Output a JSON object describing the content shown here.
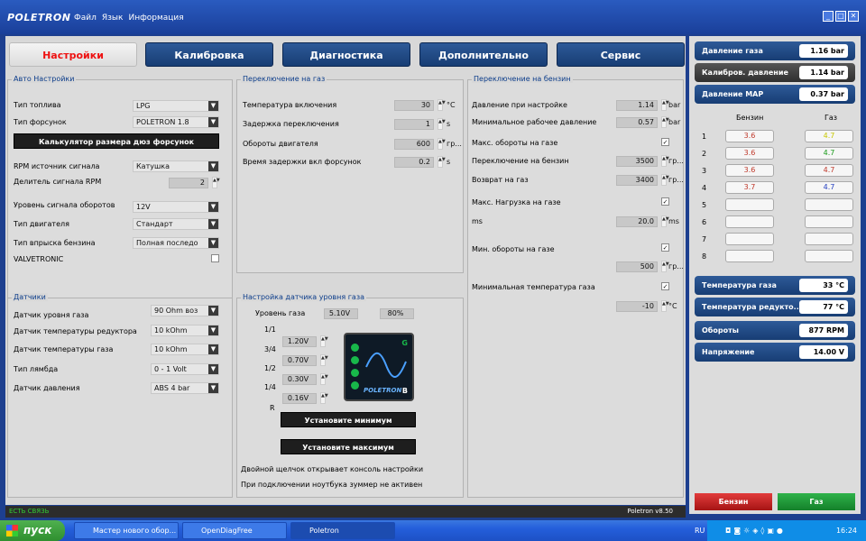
{
  "app": {
    "logo": "POLETRON",
    "menu": [
      "Файл",
      "Язык",
      "Информация"
    ]
  },
  "tabs": [
    "Настройки",
    "Калибровка",
    "Диагностика",
    "Дополнительно",
    "Сервис"
  ],
  "auto": {
    "title": "Авто Настройки",
    "fuel_type_label": "Тип топлива",
    "fuel_type": "LPG",
    "injector_type_label": "Тип форсунок",
    "injector_type": "POLETRON 1.8",
    "calc_button": "Калькулятор размера дюз форсунок",
    "rpm_source_label": "RPM источник сигнала",
    "rpm_source": "Катушка",
    "rpm_divider_label": "Делитель сигнала RPM",
    "rpm_divider": "2",
    "rpm_level_label": "Уровень сигнала оборотов",
    "rpm_level": "12V",
    "engine_type_label": "Тип двигателя",
    "engine_type": "Стандарт",
    "injection_type_label": "Тип впрыска бензина",
    "injection_type": "Полная последо",
    "valvetronic_label": "VALVETRONIC"
  },
  "gas_switch": {
    "title": "Переключение на газ",
    "temp_label": "Температура включения",
    "temp": "30",
    "temp_unit": "°C",
    "delay_label": "Задержка переключения",
    "delay": "1",
    "delay_unit": "s",
    "rpm_label": "Обороты двигателя",
    "rpm": "600",
    "rpm_unit": "гр...",
    "inj_delay_label": "Время задержки вкл форсунок",
    "inj_delay": "0.2",
    "inj_delay_unit": "s"
  },
  "petrol_switch": {
    "title": "Переключение на бензин",
    "pressure_label": "Давление при настройке",
    "pressure": "1.14",
    "pressure_unit": "bar",
    "min_pressure_label": "Минимальное рабочее давление",
    "min_pressure": "0.57",
    "min_pressure_unit": "bar",
    "max_rpm_label": "Макс. обороты на газе",
    "switch_label": "Переключение на бензин",
    "switch_val": "3500",
    "switch_unit": "гр...",
    "return_label": "Возврат на газ",
    "return_val": "3400",
    "return_unit": "гр...",
    "max_load_label": "Макс. Нагрузка на газе",
    "ms_label": "ms",
    "ms_val": "20.0",
    "ms_unit": "ms",
    "min_rpm_label": "Мин. обороты на газе",
    "min_rpm_val": "500",
    "min_rpm_unit": "гр...",
    "min_temp_label": "Минимальная температура газа",
    "min_temp_val": "-10",
    "min_temp_unit": "°C"
  },
  "sensors": {
    "title": "Датчики",
    "gas_level_label": "Датчик уровня газа",
    "gas_level": "90 Ohm воз",
    "reducer_temp_label": "Датчик температуры редуктора",
    "reducer_temp": "10 kOhm",
    "gas_temp_label": "Датчик температуры газа",
    "gas_temp": "10 kOhm",
    "lambda_label": "Тип лямбда",
    "lambda": "0 - 1 Volt",
    "pressure_label": "Датчик давления",
    "pressure": "ABS 4 bar"
  },
  "level": {
    "title": "Настройка датчика уровня газа",
    "level_label": "Уровень газа",
    "level_v": "5.10V",
    "level_pct": "80%",
    "rows": [
      {
        "label": "1/1",
        "value": "1.20V"
      },
      {
        "label": "3/4",
        "value": "0.70V"
      },
      {
        "label": "1/2",
        "value": "0.30V"
      },
      {
        "label": "1/4",
        "value": "0.16V"
      },
      {
        "label": "R",
        "value": ""
      }
    ],
    "indicator_g": "G",
    "indicator_b": "B",
    "indicator_brand": "POLETRON",
    "set_min": "Установите минимум",
    "set_max": "Установите максимум",
    "note1": "Двойной щелчок открывает консоль настройки",
    "note2": "При подключении ноутбука зуммер не активен"
  },
  "status": {
    "left": "ЕСТЬ СВЯЗЬ",
    "version": "Poletron v8.50"
  },
  "side": {
    "gas_pressure_label": "Давление газа",
    "gas_pressure": "1.16 bar",
    "cal_pressure_label": "Калибров. давление",
    "cal_pressure": "1.14 bar",
    "map_label": "Давление MAP",
    "map": "0.37 bar",
    "col_petrol": "Бензин",
    "col_gas": "Газ",
    "injectors": [
      {
        "n": "1",
        "petrol": "3.6",
        "gas": "4.7",
        "petrol_color": "#c0392b",
        "gas_color": "#c7c700"
      },
      {
        "n": "2",
        "petrol": "3.6",
        "gas": "4.7",
        "petrol_color": "#c0392b",
        "gas_color": "#1a9a1a"
      },
      {
        "n": "3",
        "petrol": "3.6",
        "gas": "4.7",
        "petrol_color": "#c0392b",
        "gas_color": "#c0392b"
      },
      {
        "n": "4",
        "petrol": "3.7",
        "gas": "4.7",
        "petrol_color": "#c0392b",
        "gas_color": "#2540c0"
      },
      {
        "n": "5",
        "petrol": "",
        "gas": ""
      },
      {
        "n": "6",
        "petrol": "",
        "gas": ""
      },
      {
        "n": "7",
        "petrol": "",
        "gas": ""
      },
      {
        "n": "8",
        "petrol": "",
        "gas": ""
      }
    ],
    "gas_temp_label": "Температура газа",
    "gas_temp": "33 °C",
    "reducer_temp_label": "Температура редукто...",
    "reducer_temp": "77 °C",
    "rpm_label": "Обороты",
    "rpm": "877 RPM",
    "voltage_label": "Напряжение",
    "voltage": "14.00 V",
    "petrol_btn": "Бензин",
    "gas_btn": "Газ"
  },
  "taskbar": {
    "start": "пуск",
    "items": [
      "Мастер нового обор...",
      "OpenDiagFree",
      "Poletron"
    ],
    "lang": "RU",
    "time": "16:24"
  }
}
